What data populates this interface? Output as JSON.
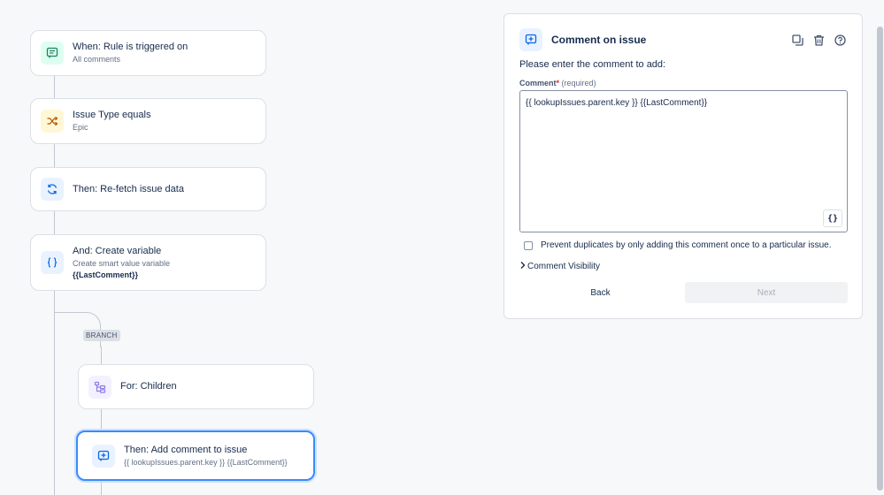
{
  "flow": {
    "nodes": [
      {
        "title": "When: Rule is triggered on",
        "subtitle": "All comments",
        "icon": "comment-icon"
      },
      {
        "title": "Issue Type equals",
        "subtitle": "Epic",
        "icon": "shuffle-icon"
      },
      {
        "title": "Then: Re-fetch issue data",
        "icon": "refresh-icon"
      },
      {
        "title": "And: Create variable",
        "subtitle": "Create smart value variable",
        "detail": "{{LastComment}}",
        "icon": "braces-icon"
      },
      {
        "title": "For: Children",
        "icon": "hierarchy-icon"
      },
      {
        "title": "Then: Add comment to issue",
        "subtitle": "{{ lookupIssues.parent.key }} {{LastComment}}",
        "icon": "add-comment-icon"
      }
    ],
    "branch_label": "BRANCH"
  },
  "panel": {
    "title": "Comment on issue",
    "prompt": "Please enter the comment to add:",
    "field_label": "Comment",
    "required_mark": "*",
    "required_text": "(required)",
    "comment_value": "{{ lookupIssues.parent.key }} {{LastComment}}",
    "smart_value_button": "{}",
    "prevent_duplicates_label": "Prevent duplicates by only adding this comment once to a particular issue.",
    "visibility_label": "Comment Visibility",
    "back_label": "Back",
    "next_label": "Next"
  },
  "colors": {
    "accent": "#388bff",
    "trigger_icon_bg": "#dcfff1",
    "condition_icon_bg": "#fff7d6",
    "action_icon_bg": "#e9f2ff",
    "branch_icon_bg": "#f3f0ff"
  }
}
